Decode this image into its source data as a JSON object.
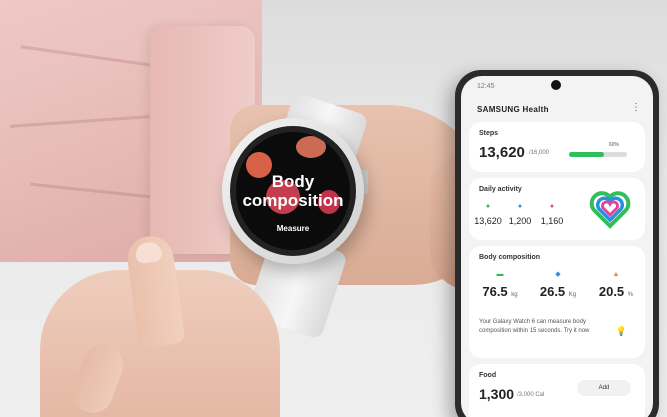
{
  "watch": {
    "title_line1": "Body",
    "title_line2": "composition",
    "action": "Measure"
  },
  "phone": {
    "status_time": "12:45",
    "app_title": "SAMSUNG Health",
    "steps": {
      "title": "Steps",
      "value": "13,620",
      "goal": "/16,000",
      "percent_label": "60%",
      "progress": 0.6,
      "bar_color": "#2fbf5a"
    },
    "daily_activity": {
      "title": "Daily activity",
      "items": [
        {
          "icon": "shoe-icon",
          "value": "13,620",
          "color": "#2fbf5a"
        },
        {
          "icon": "clock-icon",
          "value": "1,200",
          "color": "#2b8fe0"
        },
        {
          "icon": "flame-icon",
          "value": "1,160",
          "color": "#e0459a"
        }
      ]
    },
    "body_composition": {
      "title": "Body composition",
      "metrics": [
        {
          "icon": "weight-icon",
          "value": "76.5",
          "unit": "kg",
          "color": "#2fbf5a"
        },
        {
          "icon": "muscle-icon",
          "value": "26.5",
          "unit": "Kg",
          "color": "#2b8fe0"
        },
        {
          "icon": "fat-icon",
          "value": "20.5",
          "unit": "%",
          "color": "#e08a2b"
        }
      ],
      "description": "Your Galaxy Watch 6 can measure body composition within 15 seconds. Try it now"
    },
    "food": {
      "title": "Food",
      "value": "1,300",
      "goal": "/3,000 Cal",
      "add_label": "Add"
    }
  }
}
